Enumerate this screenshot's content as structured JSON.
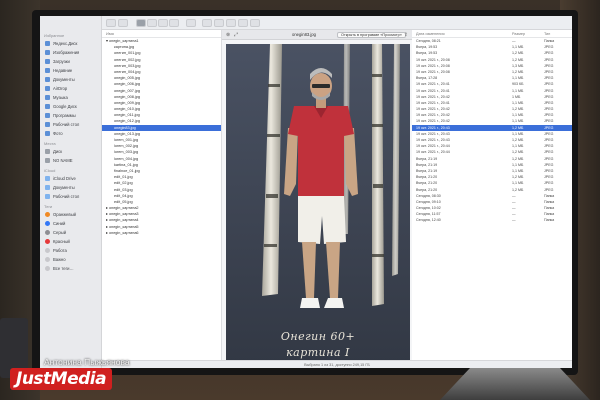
{
  "sidebar": {
    "favorites_head": "Избранное",
    "favorites": [
      "Яндекс.Диск",
      "Изображения",
      "Загрузки",
      "Недавние",
      "Документы",
      "AirDrop",
      "Музыка",
      "Google Диск",
      "Программы",
      "Рабочий стол",
      "Фото"
    ],
    "locations_head": "Места",
    "locations": [
      "Диск",
      "NO NAME"
    ],
    "icloud_head": "iCloud",
    "icloud": [
      "iCloud Drive",
      "Документы",
      "Рабочий стол"
    ],
    "tags_head": "Теги",
    "tags": [
      {
        "label": "Оранжевый",
        "color": "#f08a24"
      },
      {
        "label": "Синий",
        "color": "#3478f6"
      },
      {
        "label": "Серый",
        "color": "#8e8e93"
      },
      {
        "label": "Красный",
        "color": "#e5393a"
      },
      {
        "label": "Работа",
        "color": "#c8c8cc"
      },
      {
        "label": "Важно",
        "color": "#c8c8cc"
      },
      {
        "label": "Все теги…",
        "color": "#c8c8cc"
      }
    ]
  },
  "toolbar": {
    "arrange_label": "Имя"
  },
  "files": {
    "header": "Имя",
    "folder": "onegin_картина1",
    "items": [
      "картина.jpg",
      "онегин_001.jpg",
      "онегин_002.jpg",
      "онегин_003.jpg",
      "онегин_004.jpg",
      "onegin_005.jpg",
      "onegin_006.jpg",
      "onegin_007.jpg",
      "onegin_008.jpg",
      "onegin_009.jpg",
      "onegin_010.jpg",
      "onegin_011.jpg",
      "onegin_012.jpg",
      "onegin83.jpg",
      "onegin_013.jpg",
      "lorem_001.jpg",
      "lorem_002.jpg",
      "lorem_003.jpg",
      "lorem_004.jpg",
      "kartina_01.jpg",
      "finalnoe_01.jpg",
      "edit_01.jpg",
      "edit_02.jpg",
      "edit_03.jpg",
      "edit_04.jpg",
      "edit_05.jpg"
    ],
    "selected_index": 13,
    "subfolders": [
      "onegin_картина2",
      "onegin_картина3",
      "onegin_картина4",
      "onegin_картина5",
      "onegin_картина6"
    ]
  },
  "preview": {
    "filename": "onegin83.jpg",
    "open_button": "Открыть в программе «Просмотр»",
    "caption_line1": "Онегин 60+",
    "caption_line2": "картина I"
  },
  "details": {
    "col_date": "Дата изменения",
    "col_size": "Размер",
    "col_kind": "Тип",
    "rows": [
      {
        "date": "Сегодня, 08:21",
        "size": "—",
        "kind": "Папка"
      },
      {
        "date": "Вчера, 19:53",
        "size": "1,1 МБ",
        "kind": "JPEG"
      },
      {
        "date": "Вчера, 19:53",
        "size": "1,2 МБ",
        "kind": "JPEG"
      },
      {
        "date": "19 окт. 2021 г., 20:08",
        "size": "1,2 МБ",
        "kind": "JPEG"
      },
      {
        "date": "19 окт. 2021 г., 20:08",
        "size": "1,3 МБ",
        "kind": "JPEG"
      },
      {
        "date": "19 окт. 2021 г., 20:08",
        "size": "1,2 МБ",
        "kind": "JPEG"
      },
      {
        "date": "Вчера, 17:28",
        "size": "1,1 МБ",
        "kind": "JPEG"
      },
      {
        "date": "19 окт. 2021 г., 20:41",
        "size": "903 КБ",
        "kind": "JPEG"
      },
      {
        "date": "19 окт. 2021 г., 20:41",
        "size": "1,1 МБ",
        "kind": "JPEG"
      },
      {
        "date": "19 окт. 2021 г., 20:42",
        "size": "1 МБ",
        "kind": "JPEG"
      },
      {
        "date": "19 окт. 2021 г., 20:41",
        "size": "1,1 МБ",
        "kind": "JPEG"
      },
      {
        "date": "19 окт. 2021 г., 20:42",
        "size": "1,2 МБ",
        "kind": "JPEG"
      },
      {
        "date": "19 окт. 2021 г., 20:42",
        "size": "1,1 МБ",
        "kind": "JPEG"
      },
      {
        "date": "19 окт. 2021 г., 20:42",
        "size": "1,1 МБ",
        "kind": "JPEG"
      },
      {
        "date": "19 окт. 2021 г., 20:43",
        "size": "1,2 МБ",
        "kind": "JPEG"
      },
      {
        "date": "19 окт. 2021 г., 20:43",
        "size": "1,1 МБ",
        "kind": "JPEG"
      },
      {
        "date": "19 окт. 2021 г., 20:43",
        "size": "1,2 МБ",
        "kind": "JPEG"
      },
      {
        "date": "19 окт. 2021 г., 20:44",
        "size": "1,1 МБ",
        "kind": "JPEG"
      },
      {
        "date": "19 окт. 2021 г., 20:44",
        "size": "1,2 МБ",
        "kind": "JPEG"
      },
      {
        "date": "Вчера, 21:19",
        "size": "1,2 МБ",
        "kind": "JPEG"
      },
      {
        "date": "Вчера, 21:19",
        "size": "1,1 МБ",
        "kind": "JPEG"
      },
      {
        "date": "Вчера, 21:19",
        "size": "1,1 МБ",
        "kind": "JPEG"
      },
      {
        "date": "Вчера, 21:20",
        "size": "1,2 МБ",
        "kind": "JPEG"
      },
      {
        "date": "Вчера, 21:20",
        "size": "1,1 МБ",
        "kind": "JPEG"
      },
      {
        "date": "Вчера, 21:20",
        "size": "1,2 МБ",
        "kind": "JPEG"
      },
      {
        "date": "Сегодня, 08:30",
        "size": "—",
        "kind": "Папка"
      },
      {
        "date": "Сегодня, 09:10",
        "size": "—",
        "kind": "Папка"
      },
      {
        "date": "Сегодня, 10:02",
        "size": "—",
        "kind": "Папка"
      },
      {
        "date": "Сегодня, 11:57",
        "size": "—",
        "kind": "Папка"
      },
      {
        "date": "Сегодня, 12:40",
        "size": "—",
        "kind": "Папка"
      }
    ],
    "selected_index": 14
  },
  "statusbar": {
    "text": "Выбрано 1 из 31, доступно 249,15 ГБ"
  },
  "watermark": {
    "credit": "Антонина Пыжьянова",
    "logo": "JustMedia"
  }
}
